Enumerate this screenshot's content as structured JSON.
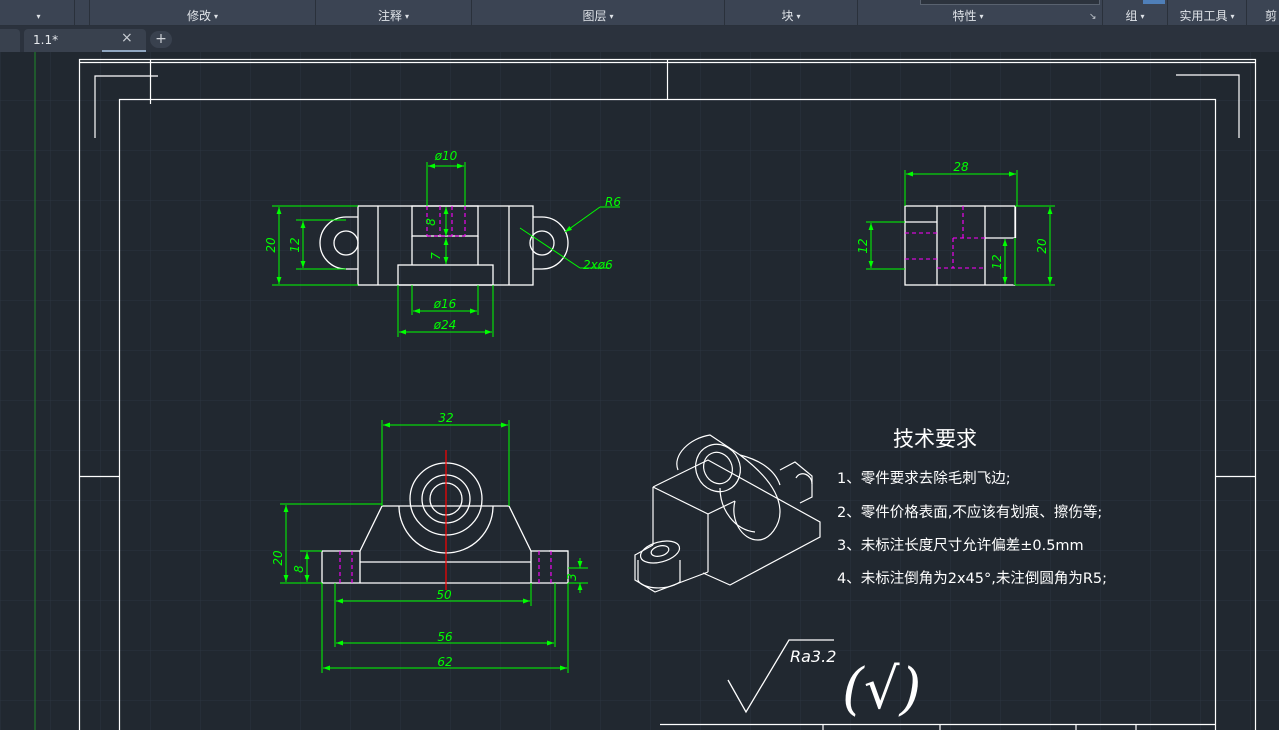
{
  "ribbon": {
    "panels": [
      {
        "id": "modify",
        "label": "修改"
      },
      {
        "id": "annotation",
        "label": "注释"
      },
      {
        "id": "layers",
        "label": "图层"
      },
      {
        "id": "block",
        "label": "块"
      },
      {
        "id": "properties",
        "label": "特性"
      },
      {
        "id": "groups",
        "label": "组"
      },
      {
        "id": "utilities",
        "label": "实用工具"
      },
      {
        "id": "clipboard",
        "label": "剪"
      }
    ]
  },
  "tabs": {
    "active": {
      "label": "1.1*"
    },
    "close_glyph": "×",
    "add_glyph": "+"
  },
  "drawing": {
    "dims": {
      "phi10": "ø10",
      "r6": "R6",
      "d20_left": "20",
      "d12_left": "12",
      "d8_v": "8",
      "d7": "7",
      "hole2": "2xø6",
      "phi16": "ø16",
      "phi24": "ø24",
      "d28": "28",
      "d12_side_a": "12",
      "d12_side_b": "12",
      "d20_side": "20",
      "d32": "32",
      "d20_front": "20",
      "d8_front": "8",
      "d50": "50",
      "d3": "3",
      "d56": "56",
      "d62": "62"
    },
    "tech": {
      "title": "技术要求",
      "items": [
        "1、零件要求去除毛刺飞边;",
        "2、零件价格表面,不应该有划痕、擦伤等;",
        "3、未标注长度尺寸允许偏差±0.5mm",
        "4、未标注倒角为2x45°,未注倒圆角为R5;"
      ]
    },
    "roughness": "Ra3.2",
    "roughness_paren": "(√)"
  },
  "colors": {
    "background": "#212830",
    "ribbon": "#3b4453",
    "frame": "#ffffff",
    "dimension": "#00ff00",
    "hidden_line": "#ff00ff",
    "center_line": "#ff0000",
    "grid": "#2c3540"
  }
}
